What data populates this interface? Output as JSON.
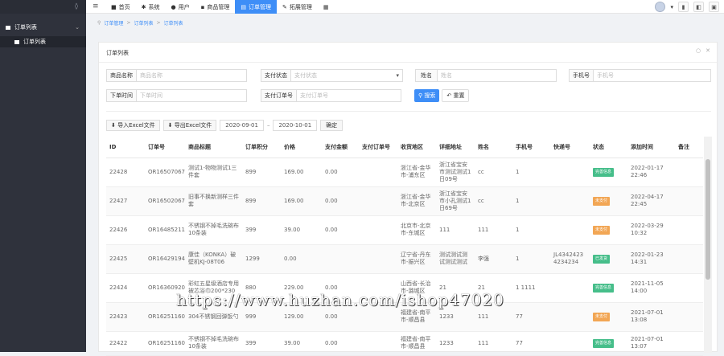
{
  "sidebar": {
    "group_label": "订单列表",
    "item_label": "订单列表"
  },
  "topbar": {
    "nav": [
      {
        "label": "首页",
        "icon": "home-icon"
      },
      {
        "label": "系统",
        "icon": "gear-icon"
      },
      {
        "label": "用户",
        "icon": "user-icon"
      },
      {
        "label": "商品管理",
        "icon": "box-icon"
      },
      {
        "label": "订单管理",
        "icon": "list-icon",
        "active": true
      },
      {
        "label": "拓展管理",
        "icon": "tool-icon"
      }
    ]
  },
  "breadcrumb": [
    "订单管理",
    "订单列表",
    "订单列表"
  ],
  "panel": {
    "title": "订单列表"
  },
  "filters": {
    "product_name_label": "商品名称",
    "product_name_placeholder": "商品名称",
    "pay_status_label": "支付状态",
    "pay_status_placeholder": "支付状态",
    "name_label": "姓名",
    "name_placeholder": "姓名",
    "phone_label": "手机号",
    "phone_placeholder": "手机号",
    "order_time_label": "下单时间",
    "order_time_placeholder": "下单时间",
    "pay_order_label": "支付订单号",
    "pay_order_placeholder": "支付订单号",
    "search_label": "搜索",
    "reset_label": "重置"
  },
  "toolbar": {
    "import_label": "导入Excel文件",
    "export_label": "导出Excel文件",
    "date_from": "2020-09-01",
    "date_to": "2020-10-01",
    "confirm_label": "确定"
  },
  "table": {
    "columns": [
      "ID",
      "订单号",
      "商品标题",
      "订单积分",
      "价格",
      "支付金额",
      "支付订单号",
      "收货地区",
      "详细地址",
      "姓名",
      "手机号",
      "快递号",
      "状态",
      "添加时间",
      "备注"
    ],
    "rows": [
      {
        "id": "22428",
        "order": "OR1650706784273",
        "title": "测试1-物物测试1三件套",
        "points": "899",
        "price": "169.00",
        "paid": "0.00",
        "pay_no": "",
        "region": "浙江省-金华市-浦东区",
        "address": "浙江省宝安市测试测试1日09号",
        "name": "cc",
        "phone": "1",
        "express": "",
        "status": "完善信息",
        "status_color": "green",
        "time": "2022-01-17 22:46"
      },
      {
        "id": "22427",
        "order": "OR1650206747998",
        "title": "旧事不换新测样三件套",
        "points": "899",
        "price": "169.00",
        "paid": "0.00",
        "pay_no": "",
        "region": "浙江省-金华市-北京区",
        "address": "浙江省宝安市小孔测试1日69号",
        "name": "cc",
        "phone": "1",
        "express": "",
        "status": "未支付",
        "status_color": "orange",
        "time": "2022-04-17 22:45"
      },
      {
        "id": "22426",
        "order": "OR1648521137964",
        "title": "不锈钢不掉毛洗碗布10条装",
        "points": "399",
        "price": "39.00",
        "paid": "0.00",
        "pay_no": "",
        "region": "北京市-北京市-东城区",
        "address": "111",
        "name": "111",
        "phone": "1",
        "express": "",
        "status": "未支付",
        "status_color": "orange",
        "time": "2022-03-29 10:32"
      },
      {
        "id": "22425",
        "order": "OR1642919494650",
        "title": "康佳（KONKA）破壁机KJ-08T06",
        "points": "1299",
        "price": "0.00",
        "paid": "",
        "pay_no": "",
        "region": "辽宁省-丹东市-振兴区",
        "address": "测试测试测试测试测试",
        "name": "李强",
        "phone": "1",
        "express": "JL4342423 4234234",
        "status": "已发货",
        "status_color": "green",
        "time": "2022-01-23 14:31"
      },
      {
        "id": "22424",
        "order": "OR1636092054886",
        "title": "彩虹五星级酒店专用被芯浴巾200*230",
        "points": "880",
        "price": "229.00",
        "paid": "0.00",
        "pay_no": "",
        "region": "山西省-长治市-潞城区",
        "address": "21",
        "name": "21",
        "phone": "1 1111",
        "express": "",
        "status": "完善信息",
        "status_color": "green",
        "time": "2021-11-05 14:00"
      },
      {
        "id": "22423",
        "order": "OR1625116095401",
        "title": "304不锈钢回弹饭勺",
        "points": "999",
        "price": "129.00",
        "paid": "0.00",
        "pay_no": "",
        "region": "福建省-南平市-顺昌县",
        "address": "1233",
        "name": "111",
        "phone": "77",
        "express": "",
        "status": "未支付",
        "status_color": "orange",
        "time": "2021-07-01 13:08"
      },
      {
        "id": "22422",
        "order": "OR1625116070731",
        "title": "不锈钢不掉毛洗碗布10条装",
        "points": "399",
        "price": "39.00",
        "paid": "0.00",
        "pay_no": "",
        "region": "福建省-南平市-顺昌县",
        "address": "1233",
        "name": "111",
        "phone": "77",
        "express": "",
        "status": "完善信息",
        "status_color": "green",
        "time": "2021-07-01 13:07"
      }
    ]
  },
  "watermark": "https://www.huzhan.com/ishop47020"
}
